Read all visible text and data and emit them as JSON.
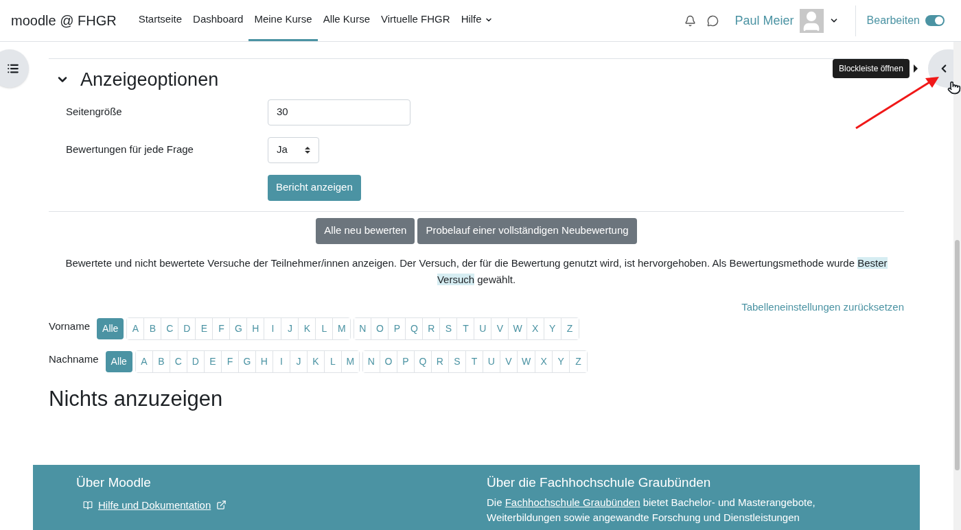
{
  "header": {
    "brand": "moodle @ FHGR",
    "nav": [
      {
        "label": "Startseite",
        "selected": false,
        "has_menu": false
      },
      {
        "label": "Dashboard",
        "selected": false,
        "has_menu": false
      },
      {
        "label": "Meine Kurse",
        "selected": true,
        "has_menu": false
      },
      {
        "label": "Alle Kurse",
        "selected": false,
        "has_menu": false
      },
      {
        "label": "Virtuelle FHGR",
        "selected": false,
        "has_menu": false
      },
      {
        "label": "Hilfe",
        "selected": false,
        "has_menu": true
      }
    ],
    "user_name": "Paul Meier",
    "edit_label": "Bearbeiten",
    "edit_on": true
  },
  "tooltip": "Blockleiste öffnen",
  "section": {
    "title": "Anzeigeoptionen",
    "expanded": true,
    "fields": [
      {
        "kind": "text",
        "label": "Seitengröße",
        "value": "30"
      },
      {
        "kind": "select",
        "label": "Bewertungen für jede Frage",
        "value": "Ja"
      }
    ],
    "submit": "Bericht anzeigen"
  },
  "actions": [
    "Alle neu bewerten",
    "Probelauf einer vollständigen Neubewertung"
  ],
  "info": {
    "before": "Bewertete und nicht bewertete Versuche der Teilnehmer/innen anzeigen. Der Versuch, der für die Bewertung genutzt wird, ist hervorgehoben. Als Bewertungsmethode wurde",
    "highlight": "Bester Versuch",
    "after": "gewählt."
  },
  "reset_link": "Tabelleneinstellungen zurücksetzen",
  "filters": [
    {
      "label": "Vorname",
      "all": {
        "label": "Alle",
        "selected": true
      },
      "groups": [
        [
          {
            "label": "A",
            "selected": false
          },
          {
            "label": "B",
            "selected": false
          },
          {
            "label": "C",
            "selected": false
          },
          {
            "label": "D",
            "selected": false
          },
          {
            "label": "E",
            "selected": false
          },
          {
            "label": "F",
            "selected": false
          },
          {
            "label": "G",
            "selected": false
          },
          {
            "label": "H",
            "selected": false
          },
          {
            "label": "I",
            "selected": false
          },
          {
            "label": "J",
            "selected": false
          },
          {
            "label": "K",
            "selected": false
          },
          {
            "label": "L",
            "selected": false
          },
          {
            "label": "M",
            "selected": false
          }
        ],
        [
          {
            "label": "N",
            "selected": false
          },
          {
            "label": "O",
            "selected": false
          },
          {
            "label": "P",
            "selected": false
          },
          {
            "label": "Q",
            "selected": false
          },
          {
            "label": "R",
            "selected": false
          },
          {
            "label": "S",
            "selected": false
          },
          {
            "label": "T",
            "selected": false
          },
          {
            "label": "U",
            "selected": false
          },
          {
            "label": "V",
            "selected": false
          },
          {
            "label": "W",
            "selected": false
          },
          {
            "label": "X",
            "selected": false
          },
          {
            "label": "Y",
            "selected": false
          },
          {
            "label": "Z",
            "selected": false
          }
        ]
      ]
    },
    {
      "label": "Nachname",
      "all": {
        "label": "Alle",
        "selected": true
      },
      "groups": [
        [
          {
            "label": "A",
            "selected": false
          },
          {
            "label": "B",
            "selected": false
          },
          {
            "label": "C",
            "selected": false
          },
          {
            "label": "D",
            "selected": false
          },
          {
            "label": "E",
            "selected": false
          },
          {
            "label": "F",
            "selected": false
          },
          {
            "label": "G",
            "selected": false
          },
          {
            "label": "H",
            "selected": false
          },
          {
            "label": "I",
            "selected": false
          },
          {
            "label": "J",
            "selected": false
          },
          {
            "label": "K",
            "selected": false
          },
          {
            "label": "L",
            "selected": false
          },
          {
            "label": "M",
            "selected": false
          }
        ],
        [
          {
            "label": "N",
            "selected": false
          },
          {
            "label": "O",
            "selected": false
          },
          {
            "label": "P",
            "selected": false
          },
          {
            "label": "Q",
            "selected": false
          },
          {
            "label": "R",
            "selected": false
          },
          {
            "label": "S",
            "selected": false
          },
          {
            "label": "T",
            "selected": false
          },
          {
            "label": "U",
            "selected": false
          },
          {
            "label": "V",
            "selected": false
          },
          {
            "label": "W",
            "selected": false
          },
          {
            "label": "X",
            "selected": false
          },
          {
            "label": "Y",
            "selected": false
          },
          {
            "label": "Z",
            "selected": false
          }
        ]
      ]
    }
  ],
  "empty_message": "Nichts anzuzeigen",
  "footer": {
    "left_title": "Über Moodle",
    "left_link": "Hilfe und Dokumentation",
    "right_title": "Über die Fachhochschule Graubünden",
    "right_before": "Die",
    "right_link": "Fachhochschule Graubünden",
    "right_after": "bietet Bachelor- und Masterangebote,",
    "right_line2": "Weiterbildungen sowie angewandte Forschung und Dienstleistungen"
  }
}
